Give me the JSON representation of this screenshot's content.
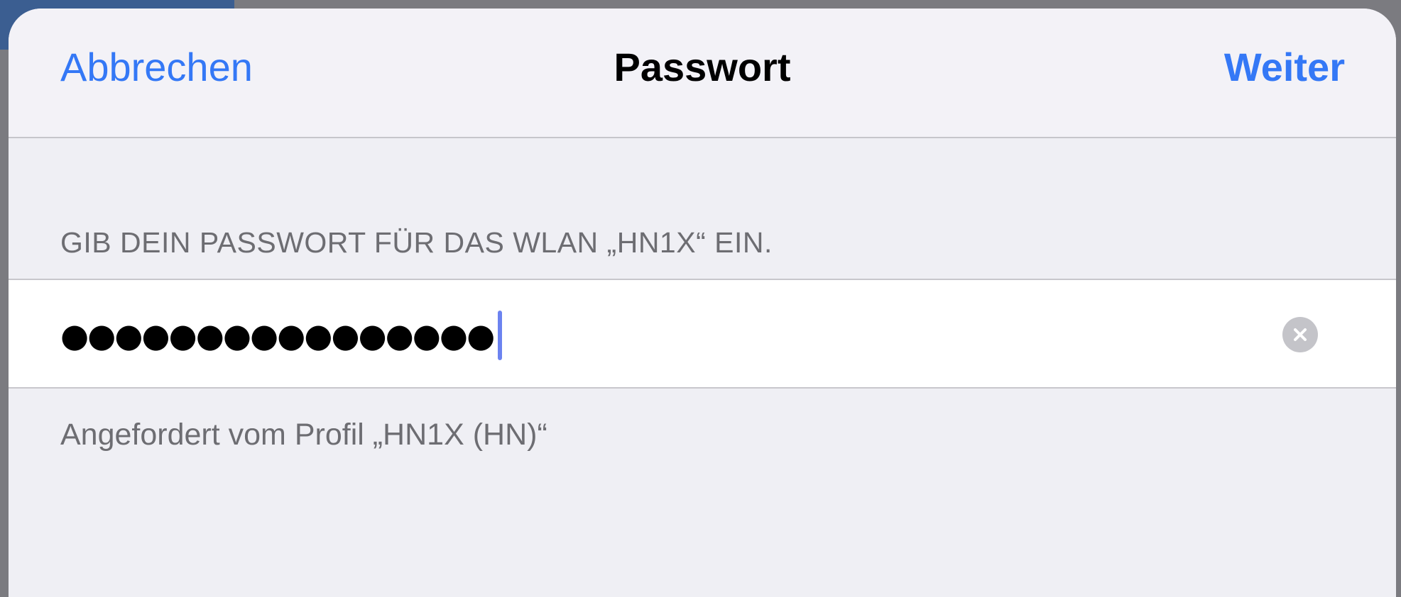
{
  "navbar": {
    "cancel_label": "Abbrechen",
    "title": "Passwort",
    "next_label": "Weiter"
  },
  "section": {
    "header": "GIB DEIN PASSWORT FÜR DAS WLAN „HN1X“ EIN."
  },
  "password_field": {
    "masked_value": "●●●●●●●●●●●●●●●●",
    "clear_icon": "clear-x-circle-icon"
  },
  "footer": {
    "note": "Angefordert vom Profil „HN1X (HN)“"
  },
  "colors": {
    "accent": "#3478f6",
    "background": "#efeff4",
    "secondary_text": "#6d6d72",
    "caret": "#6c83f0"
  }
}
